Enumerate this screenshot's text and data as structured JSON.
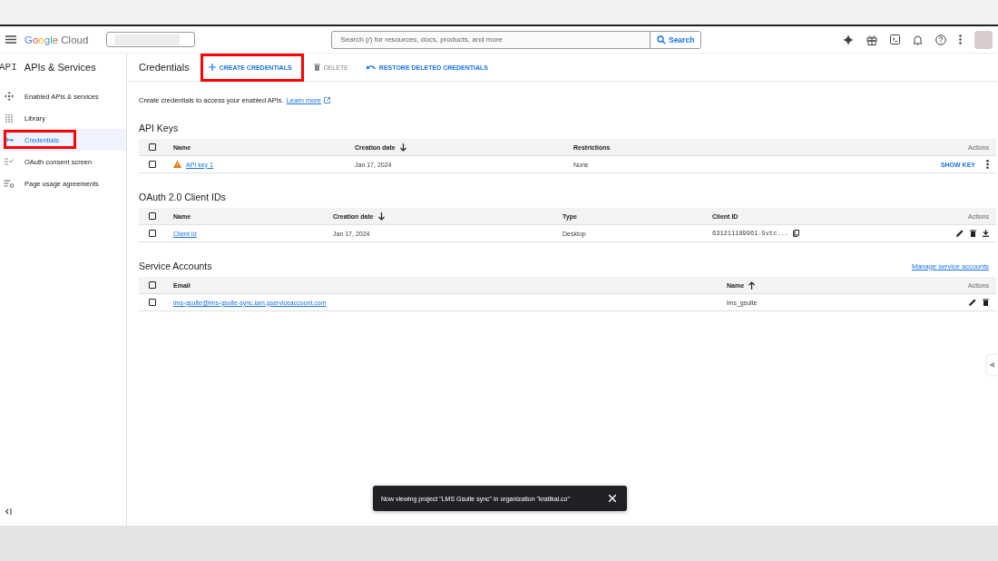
{
  "topbar": {
    "logo": "Google Cloud",
    "search": {
      "placeholder": "Search (/) for resources, docs, products, and more",
      "button": "Search"
    }
  },
  "sidebar": {
    "logo": "API",
    "title": "APIs & Services",
    "items": [
      {
        "label": "Enabled APIs & services",
        "kind": "enabled",
        "selected": false,
        "highlighted": false
      },
      {
        "label": "Library",
        "kind": "library",
        "selected": false,
        "highlighted": false
      },
      {
        "label": "Credentials",
        "kind": "credentials",
        "selected": true,
        "highlighted": true
      },
      {
        "label": "OAuth consent screen",
        "kind": "consent",
        "selected": false,
        "highlighted": false
      },
      {
        "label": "Page usage agreements",
        "kind": "usage",
        "selected": false,
        "highlighted": false
      }
    ]
  },
  "header": {
    "title": "Credentials",
    "actions": [
      {
        "label": "CREATE CREDENTIALS",
        "kind": "create",
        "disabled": false,
        "highlighted": true
      },
      {
        "label": "DELETE",
        "kind": "delete",
        "disabled": true,
        "highlighted": false
      },
      {
        "label": "RESTORE DELETED CREDENTIALS",
        "kind": "restore",
        "disabled": false,
        "highlighted": false
      }
    ]
  },
  "intro": {
    "text": "Create credentials to access your enabled APIs.",
    "link": "Learn more"
  },
  "sections": [
    {
      "title": "API Keys",
      "kind": "api_keys",
      "all_checked": false,
      "columns": [
        {
          "label": "Name"
        },
        {
          "label": "Creation date",
          "ascending": false
        },
        {
          "label": "Restrictions"
        },
        {
          "label": "Actions"
        }
      ],
      "rows": [
        {
          "checked": false,
          "cells": [
            {
              "kind": "link",
              "text": "API key 1",
              "warning": true
            },
            {
              "kind": "text",
              "text": "Jan 17, 2024"
            },
            {
              "kind": "text",
              "text": "None"
            },
            {
              "kind": "actions",
              "items": [
                {
                  "kind": "show_key",
                  "label": "SHOW KEY"
                },
                {
                  "kind": "more"
                }
              ]
            }
          ]
        }
      ]
    },
    {
      "title": "OAuth 2.0 Client IDs",
      "kind": "oauth",
      "all_checked": false,
      "columns": [
        {
          "label": "Name"
        },
        {
          "label": "Creation date",
          "ascending": false
        },
        {
          "label": "Type"
        },
        {
          "label": "Client ID"
        },
        {
          "label": "Actions"
        }
      ],
      "rows": [
        {
          "checked": false,
          "cells": [
            {
              "kind": "link",
              "text": "Client Id",
              "warning": false
            },
            {
              "kind": "text",
              "text": "Jan 17, 2024"
            },
            {
              "kind": "text",
              "text": "Desktop"
            },
            {
              "kind": "mono",
              "text": "631211189961-5vtc...",
              "copyable": true
            },
            {
              "kind": "actions",
              "items": [
                {
                  "kind": "edit"
                },
                {
                  "kind": "delete"
                },
                {
                  "kind": "download"
                }
              ]
            }
          ]
        }
      ]
    },
    {
      "title": "Service Accounts",
      "kind": "service",
      "link": "Manage service accounts",
      "all_checked": false,
      "columns": [
        {
          "label": "Email"
        },
        {
          "label": "Name",
          "ascending": true
        },
        {
          "label": "Actions"
        }
      ],
      "rows": [
        {
          "checked": false,
          "cells": [
            {
              "kind": "link",
              "text": "lms-gsulte@lms-gsulte-sync.iam.gserviceaccount.com",
              "warning": false
            },
            {
              "kind": "text",
              "text": "lms_gsulte"
            },
            {
              "kind": "actions",
              "items": [
                {
                  "kind": "edit"
                },
                {
                  "kind": "delete"
                }
              ]
            }
          ]
        }
      ]
    }
  ],
  "toast": {
    "message": "Now viewing project \"LMS Gsuite sync\" in organization \"kratikal.co\""
  }
}
